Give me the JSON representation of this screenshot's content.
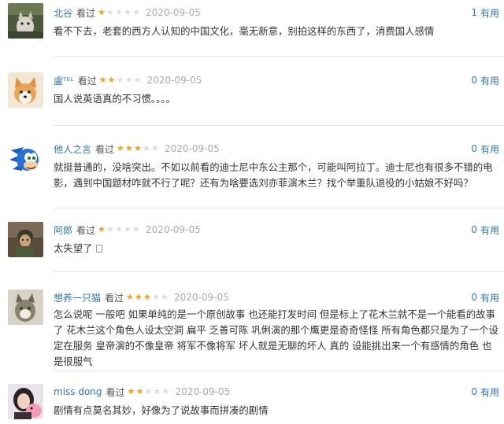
{
  "comments": [
    {
      "user": "北谷",
      "watched": "看过",
      "rating": 1,
      "date": "2020-09-05",
      "votes": "1",
      "vote_label": "有用",
      "text": "看不下去，老套的西方人认知的中国文化，毫无新意，别拍这样的东西了，消费国人感情",
      "avatar": "cat-icon"
    },
    {
      "user": "盧ᵀᴱᴸ",
      "watched": "看过",
      "rating": 2,
      "date": "2020-09-05",
      "votes": "0",
      "vote_label": "有用",
      "text": "国人说英语真的不习惯。。。。",
      "avatar": "corgi-icon"
    },
    {
      "user": "他人之言",
      "watched": "看过",
      "rating": 3,
      "date": "2020-09-05",
      "votes": "0",
      "vote_label": "有用",
      "text": "就挺普通的，没啥突出。不如以前看的迪士尼中东公主那个，可能叫阿拉丁。迪士尼也有很多不错的电影，遇到中国题材咋就不行了呢？还有为啥要选刘亦菲演木兰？找个举重队退役的小姑娘不好吗？",
      "avatar": "hedgehog-icon"
    },
    {
      "user": "阿郎",
      "watched": "看过",
      "rating": 1,
      "date": "2020-09-05",
      "votes": "0",
      "vote_label": "有用",
      "text": "太失望了",
      "avatar": "soldier-icon"
    },
    {
      "user": "想养一只猫",
      "watched": "看过",
      "rating": 3,
      "date": "2020-09-05",
      "votes": "0",
      "vote_label": "有用",
      "text": "怎么说呢 一般吧 如果单纯的是一个原创故事 也还能打发时间 但是标上了花木兰就不是一个能看的故事了 花木兰这个角色人设太空洞 扁平 乏善可陈 巩俐演的那个鹰更是奇奇怪怪 所有角色都只是为了一个设定在服务 皇帝演的不像皇帝 将军不像将军 坏人就是无聊的坏人 真的 设能挑出来一个有感情的角色 也是很服气",
      "avatar": "cat-icon"
    },
    {
      "user": "miss dong",
      "watched": "看过",
      "rating": 2,
      "date": "2020-09-05",
      "votes": "0",
      "vote_label": "有用",
      "text": "剧情有点莫名其妙，好像为了说故事而拼凑的剧情",
      "avatar": "girl-icon"
    }
  ],
  "colors": {
    "link": "#3377aa",
    "star_on": "#f4a21a",
    "star_off": "#dddddd",
    "date": "#aaaaaa"
  }
}
